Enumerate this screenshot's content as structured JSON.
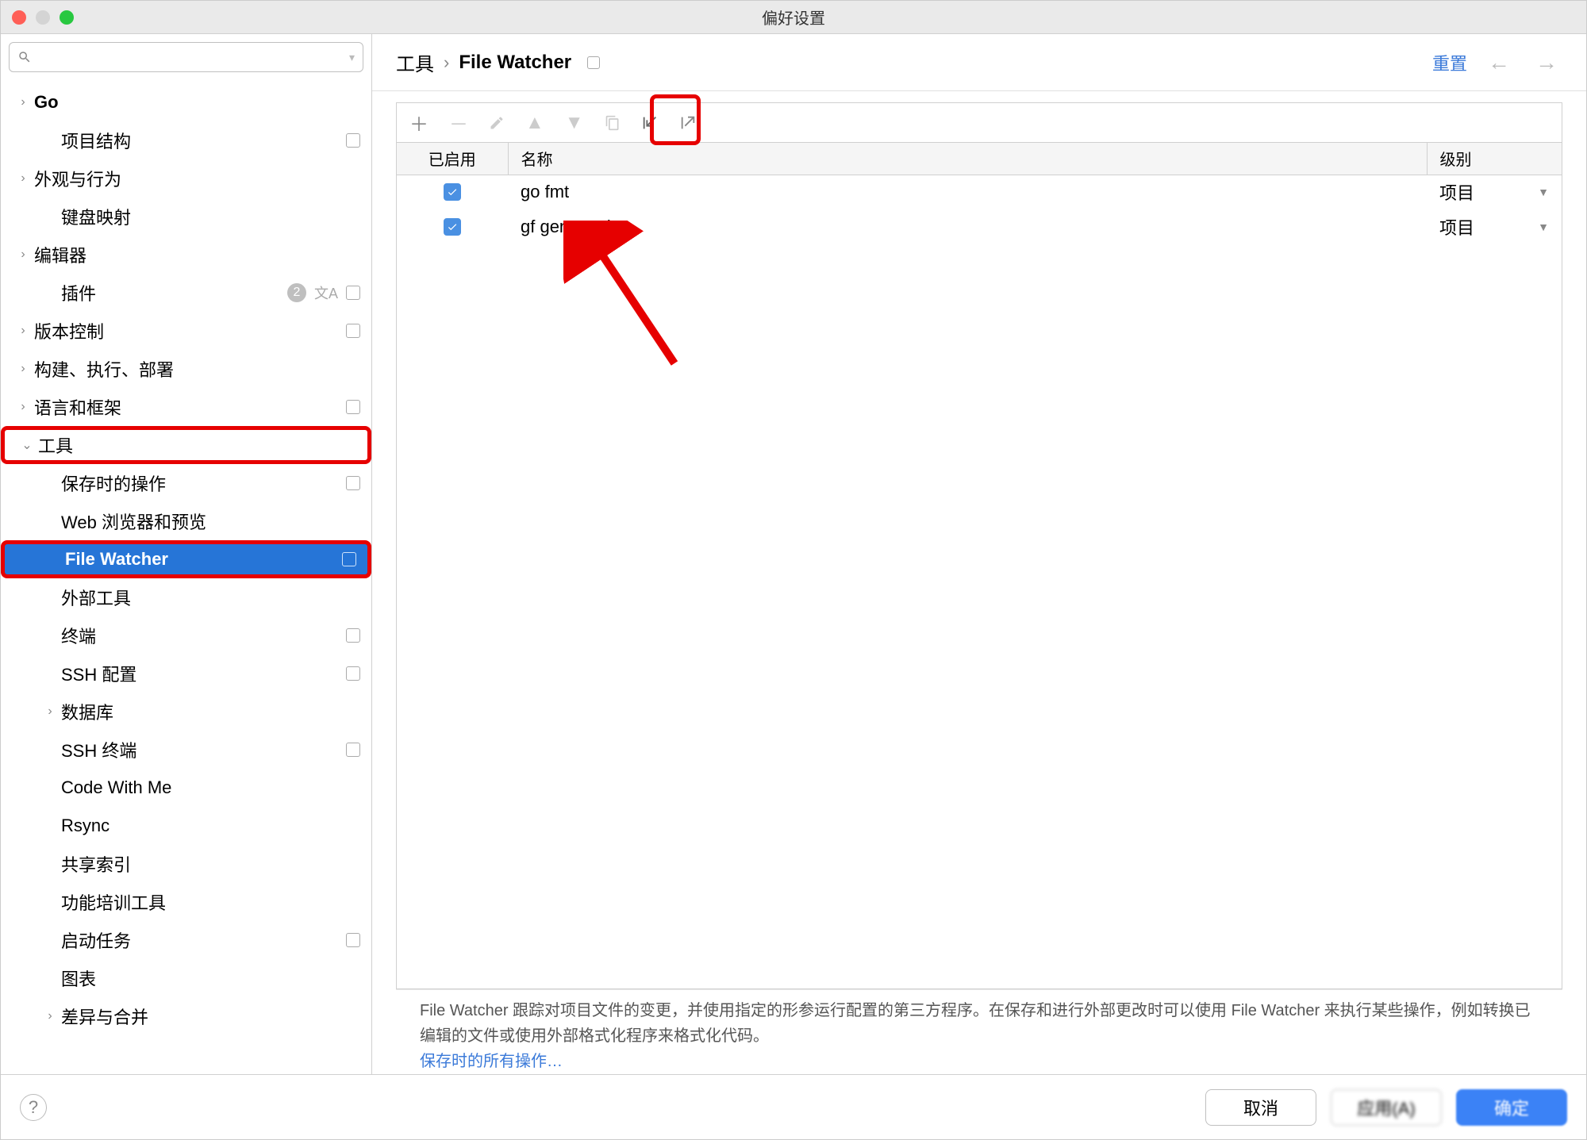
{
  "window_title": "偏好设置",
  "search_placeholder": "",
  "sidebar": {
    "items": [
      {
        "label": "Go",
        "depth": 0,
        "chev": "right",
        "bold": true
      },
      {
        "label": "项目结构",
        "depth": 1,
        "square": true
      },
      {
        "label": "外观与行为",
        "depth": 0,
        "chev": "right"
      },
      {
        "label": "键盘映射",
        "depth": 1
      },
      {
        "label": "编辑器",
        "depth": 0,
        "chev": "right"
      },
      {
        "label": "插件",
        "depth": 1,
        "badge": "2",
        "lang": true,
        "square": true
      },
      {
        "label": "版本控制",
        "depth": 0,
        "chev": "right",
        "square": true
      },
      {
        "label": "构建、执行、部署",
        "depth": 0,
        "chev": "right"
      },
      {
        "label": "语言和框架",
        "depth": 0,
        "chev": "right",
        "square": true
      },
      {
        "label": "工具",
        "depth": 0,
        "chev": "down",
        "redbox": true
      },
      {
        "label": "保存时的操作",
        "depth": 1,
        "square": true
      },
      {
        "label": "Web 浏览器和预览",
        "depth": 1
      },
      {
        "label": "File Watcher",
        "depth": 1,
        "selected": true,
        "square": true,
        "redbox": true
      },
      {
        "label": "外部工具",
        "depth": 1
      },
      {
        "label": "终端",
        "depth": 1,
        "square": true
      },
      {
        "label": "SSH 配置",
        "depth": 1,
        "square": true
      },
      {
        "label": "数据库",
        "depth": 1,
        "chev": "right"
      },
      {
        "label": "SSH 终端",
        "depth": 1,
        "square": true
      },
      {
        "label": "Code With Me",
        "depth": 1
      },
      {
        "label": "Rsync",
        "depth": 1
      },
      {
        "label": "共享索引",
        "depth": 1
      },
      {
        "label": "功能培训工具",
        "depth": 1
      },
      {
        "label": "启动任务",
        "depth": 1,
        "square": true
      },
      {
        "label": "图表",
        "depth": 1
      },
      {
        "label": "差异与合并",
        "depth": 1,
        "chev": "right"
      }
    ]
  },
  "breadcrumb": {
    "root": "工具",
    "current": "File Watcher"
  },
  "header": {
    "reset": "重置"
  },
  "table": {
    "cols": {
      "enabled": "已启用",
      "name": "名称",
      "level": "级别"
    },
    "rows": [
      {
        "enabled": true,
        "name": "go fmt",
        "level": "项目"
      },
      {
        "enabled": true,
        "name": "gf gen service",
        "level": "项目"
      }
    ]
  },
  "description": "File Watcher 跟踪对项目文件的变更，并使用指定的形参运行配置的第三方程序。在保存和进行外部更改时可以使用 File Watcher 来执行某些操作，例如转换已编辑的文件或使用外部格式化程序来格式化代码。",
  "description_link": "保存时的所有操作…",
  "footer": {
    "cancel": "取消",
    "apply": "应用(A)",
    "ok": "确定"
  }
}
